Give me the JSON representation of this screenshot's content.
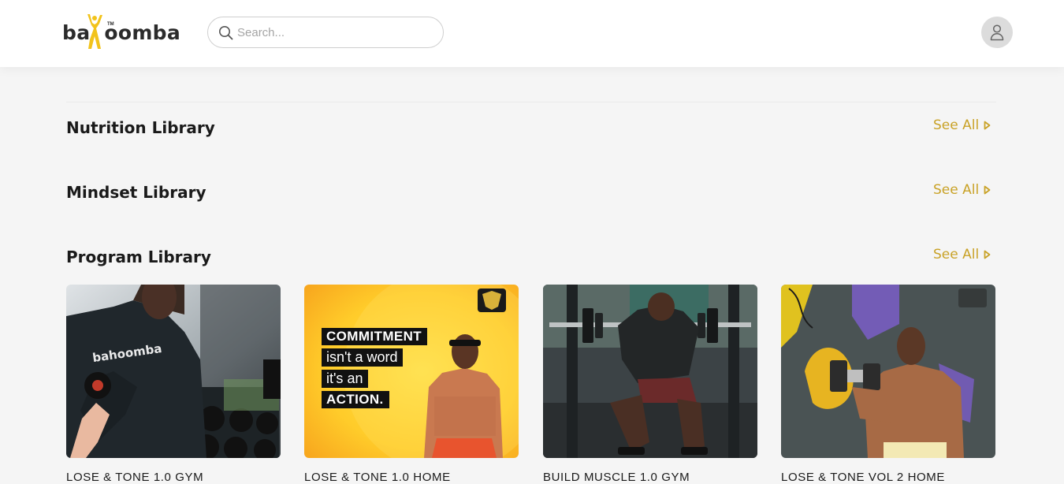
{
  "header": {
    "brand": {
      "before": "ba",
      "after": "oomba",
      "tm": "TM"
    },
    "search": {
      "placeholder": "Search..."
    },
    "icons": {
      "search": "search-icon",
      "user": "user-icon"
    }
  },
  "sections": [
    {
      "title": "Nutrition Library",
      "see_all": "See All"
    },
    {
      "title": "Mindset Library",
      "see_all": "See All"
    },
    {
      "title": "Program Library",
      "see_all": "See All"
    }
  ],
  "programs": [
    {
      "title": "LOSE & TONE 1.0 GYM",
      "overlay": "bahoomba"
    },
    {
      "title": "LOSE & TONE 1.0 HOME",
      "promo_lines": [
        "COMMITMENT",
        "isn't a word",
        "it's an",
        "ACTION."
      ]
    },
    {
      "title": "BUILD MUSCLE 1.0 GYM"
    },
    {
      "title": "LOSE & TONE VOL 2 HOME"
    }
  ],
  "colors": {
    "accent": "#c9a227",
    "brand_yellow": "#f2c31b",
    "background": "#f5f5f5"
  }
}
